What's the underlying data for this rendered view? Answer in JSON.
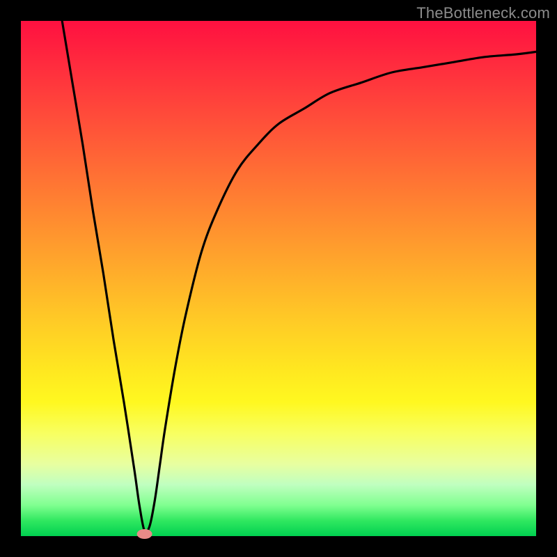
{
  "watermark": "TheBottleneck.com",
  "chart_data": {
    "type": "line",
    "title": "",
    "xlabel": "",
    "ylabel": "",
    "xlim": [
      0,
      100
    ],
    "ylim": [
      0,
      100
    ],
    "grid": false,
    "legend": false,
    "note": "Bottleneck curve with single minimum; background gradient encodes severity (red high, green low). No axis ticks visible.",
    "minimum_marker": {
      "x": 24,
      "y": 0,
      "color": "#e88a88"
    },
    "series": [
      {
        "name": "bottleneck-curve",
        "color": "#000000",
        "x": [
          8,
          10,
          12,
          14,
          16,
          18,
          20,
          22,
          23,
          24,
          25,
          26,
          27,
          28,
          30,
          32,
          35,
          38,
          42,
          46,
          50,
          55,
          60,
          66,
          72,
          78,
          84,
          90,
          96,
          100
        ],
        "values": [
          100,
          88,
          76,
          63,
          51,
          38,
          26,
          13,
          6,
          1,
          2,
          7,
          14,
          21,
          33,
          43,
          55,
          63,
          71,
          76,
          80,
          83,
          86,
          88,
          90,
          91,
          92,
          93,
          93.5,
          94
        ]
      }
    ]
  }
}
